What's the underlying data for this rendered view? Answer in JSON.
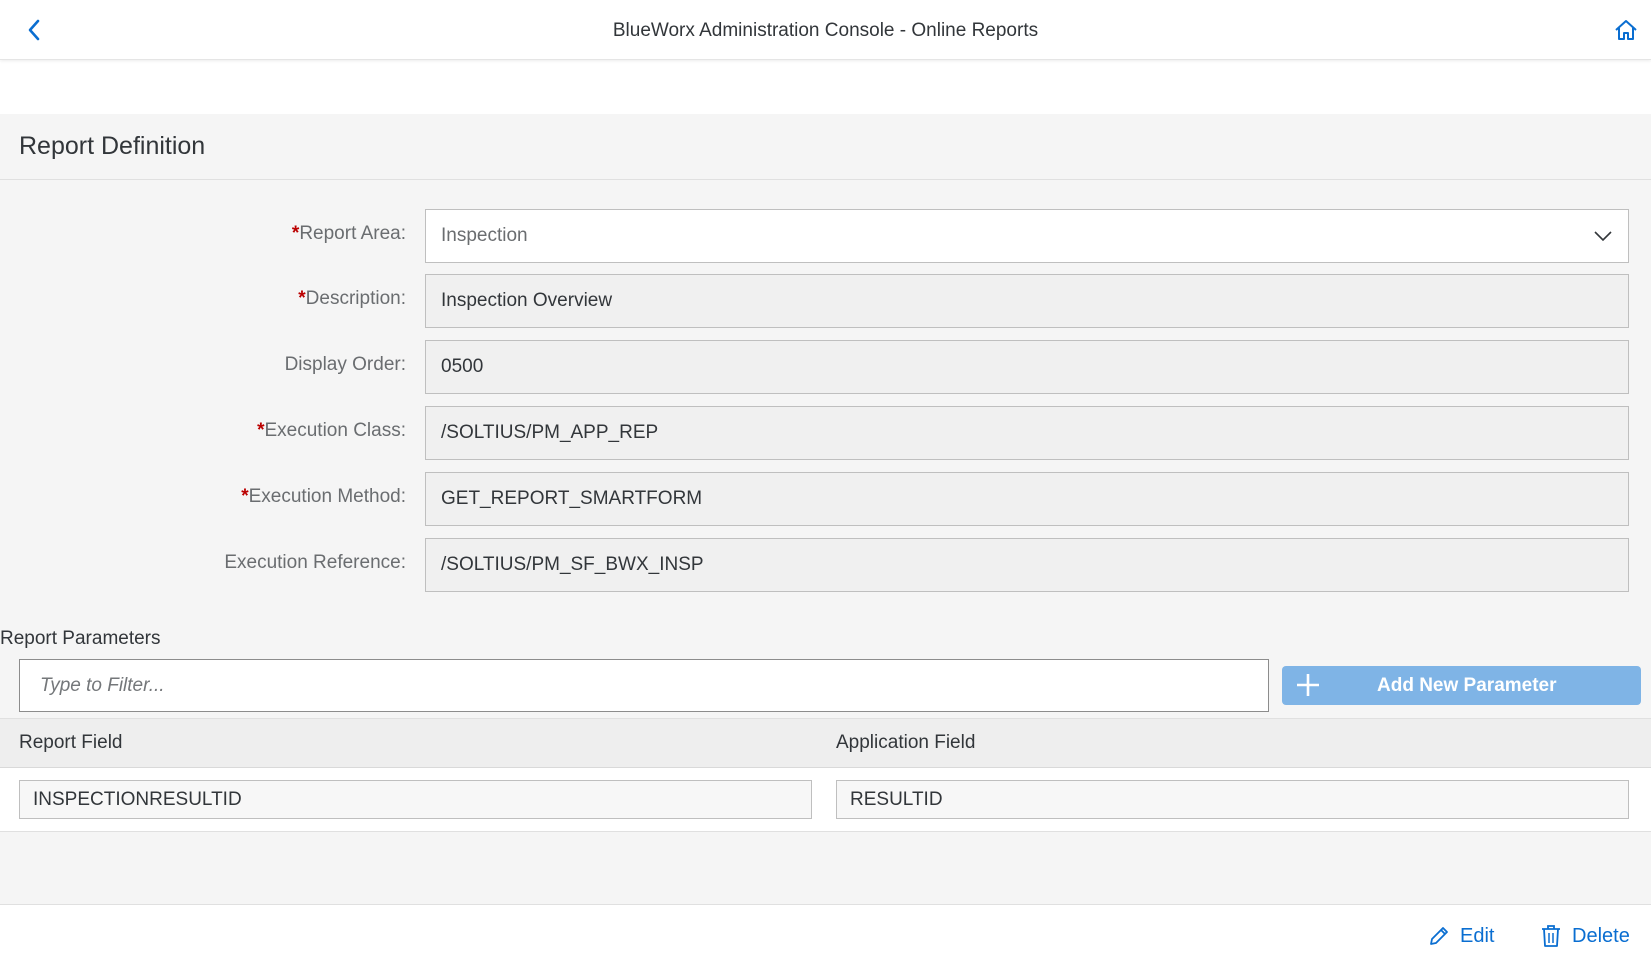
{
  "shell": {
    "title": "BlueWorx Administration Console - Online Reports",
    "back_icon": "chevron-left-icon",
    "home_icon": "home-icon"
  },
  "section": {
    "title": "Report Definition"
  },
  "form": {
    "report_area": {
      "required": "*",
      "label": "Report Area:",
      "value": "Inspection"
    },
    "description": {
      "required": "*",
      "label": "Description:",
      "value": "Inspection Overview"
    },
    "display_order": {
      "label": "Display Order:",
      "value": "0500"
    },
    "execution_class": {
      "required": "*",
      "label": "Execution Class:",
      "value": "/SOLTIUS/PM_APP_REP"
    },
    "execution_method": {
      "required": "*",
      "label": "Execution Method:",
      "value": "GET_REPORT_SMARTFORM"
    },
    "execution_reference": {
      "label": "Execution Reference:",
      "value": "/SOLTIUS/PM_SF_BWX_INSP"
    }
  },
  "parameters": {
    "label": "Report Parameters",
    "filter_placeholder": "Type to Filter...",
    "add_button_label": "Add New Parameter",
    "columns": [
      "Report Field",
      "Application Field"
    ],
    "rows": [
      {
        "report_field": "INSPECTIONRESULTID",
        "application_field": "RESULTID"
      }
    ]
  },
  "footer": {
    "edit_label": "Edit",
    "delete_label": "Delete"
  },
  "colors": {
    "accent": "#0a6ed1",
    "required": "#bb0000",
    "add_button_bg": "#7fb4e6"
  }
}
